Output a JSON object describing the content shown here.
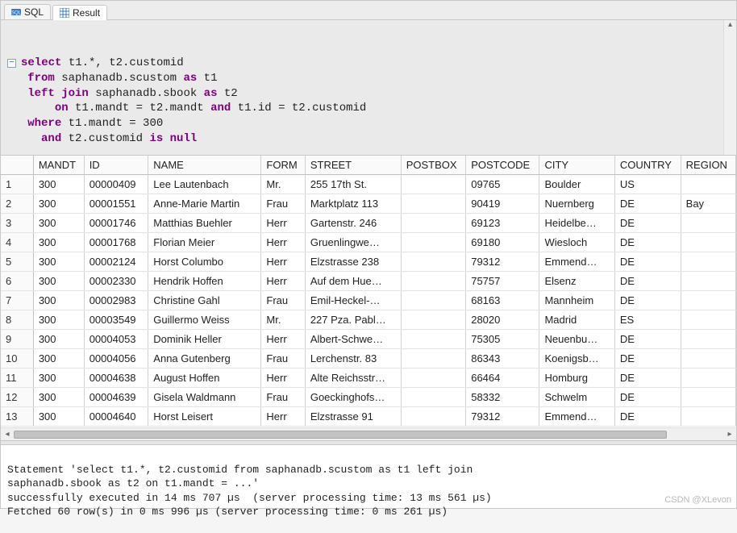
{
  "tabs": {
    "sql_label": "SQL",
    "result_label": "Result"
  },
  "sql": {
    "kw_select": "select",
    "t_sel": " t1.*, t2.customid",
    "kw_from": "from",
    "t_from": " saphanadb.scustom ",
    "kw_as1": "as",
    "t_as1": " t1",
    "kw_left": "left join",
    "t_lj": " saphanadb.sbook ",
    "kw_as2": "as",
    "t_as2": " t2",
    "kw_on": "on",
    "t_on1": " t1.mandt = t2.mandt ",
    "kw_and_on": "and",
    "t_on2": " t1.id = t2.customid",
    "kw_where": "where",
    "t_where": " t1.mandt = 300",
    "kw_and": "and",
    "t_and": " t2.customid ",
    "kw_is": "is null"
  },
  "columns": [
    "MANDT",
    "ID",
    "NAME",
    "FORM",
    "STREET",
    "POSTBOX",
    "POSTCODE",
    "CITY",
    "COUNTRY",
    "REGION"
  ],
  "rows": [
    {
      "n": "1",
      "MANDT": "300",
      "ID": "00000409",
      "NAME": "Lee Lautenbach",
      "FORM": "Mr.",
      "STREET": "255 17th St.",
      "POSTBOX": "",
      "POSTCODE": "09765",
      "CITY": "Boulder",
      "COUNTRY": "US",
      "REGION": ""
    },
    {
      "n": "2",
      "MANDT": "300",
      "ID": "00001551",
      "NAME": "Anne-Marie Martin",
      "FORM": "Frau",
      "STREET": "Marktplatz 113",
      "POSTBOX": "",
      "POSTCODE": "90419",
      "CITY": "Nuernberg",
      "COUNTRY": "DE",
      "REGION": "Bay"
    },
    {
      "n": "3",
      "MANDT": "300",
      "ID": "00001746",
      "NAME": "Matthias Buehler",
      "FORM": "Herr",
      "STREET": "Gartenstr. 246",
      "POSTBOX": "",
      "POSTCODE": "69123",
      "CITY": "Heidelbe…",
      "COUNTRY": "DE",
      "REGION": ""
    },
    {
      "n": "4",
      "MANDT": "300",
      "ID": "00001768",
      "NAME": "Florian Meier",
      "FORM": "Herr",
      "STREET": "Gruenlingwe…",
      "POSTBOX": "",
      "POSTCODE": "69180",
      "CITY": "Wiesloch",
      "COUNTRY": "DE",
      "REGION": ""
    },
    {
      "n": "5",
      "MANDT": "300",
      "ID": "00002124",
      "NAME": "Horst Columbo",
      "FORM": "Herr",
      "STREET": "Elzstrasse 238",
      "POSTBOX": "",
      "POSTCODE": "79312",
      "CITY": "Emmend…",
      "COUNTRY": "DE",
      "REGION": ""
    },
    {
      "n": "6",
      "MANDT": "300",
      "ID": "00002330",
      "NAME": "Hendrik Hoffen",
      "FORM": "Herr",
      "STREET": "Auf dem Hue…",
      "POSTBOX": "",
      "POSTCODE": "75757",
      "CITY": "Elsenz",
      "COUNTRY": "DE",
      "REGION": ""
    },
    {
      "n": "7",
      "MANDT": "300",
      "ID": "00002983",
      "NAME": "Christine Gahl",
      "FORM": "Frau",
      "STREET": "Emil-Heckel-…",
      "POSTBOX": "",
      "POSTCODE": "68163",
      "CITY": "Mannheim",
      "COUNTRY": "DE",
      "REGION": ""
    },
    {
      "n": "8",
      "MANDT": "300",
      "ID": "00003549",
      "NAME": "Guillermo Weiss",
      "FORM": "Mr.",
      "STREET": "227 Pza. Pabl…",
      "POSTBOX": "",
      "POSTCODE": "28020",
      "CITY": "Madrid",
      "COUNTRY": "ES",
      "REGION": ""
    },
    {
      "n": "9",
      "MANDT": "300",
      "ID": "00004053",
      "NAME": "Dominik Heller",
      "FORM": "Herr",
      "STREET": "Albert-Schwe…",
      "POSTBOX": "",
      "POSTCODE": "75305",
      "CITY": "Neuenbu…",
      "COUNTRY": "DE",
      "REGION": ""
    },
    {
      "n": "10",
      "MANDT": "300",
      "ID": "00004056",
      "NAME": "Anna Gutenberg",
      "FORM": "Frau",
      "STREET": "Lerchenstr. 83",
      "POSTBOX": "",
      "POSTCODE": "86343",
      "CITY": "Koenigsb…",
      "COUNTRY": "DE",
      "REGION": ""
    },
    {
      "n": "11",
      "MANDT": "300",
      "ID": "00004638",
      "NAME": "August Hoffen",
      "FORM": "Herr",
      "STREET": "Alte Reichsstr…",
      "POSTBOX": "",
      "POSTCODE": "66464",
      "CITY": "Homburg",
      "COUNTRY": "DE",
      "REGION": ""
    },
    {
      "n": "12",
      "MANDT": "300",
      "ID": "00004639",
      "NAME": "Gisela Waldmann",
      "FORM": "Frau",
      "STREET": "Goeckinghofs…",
      "POSTBOX": "",
      "POSTCODE": "58332",
      "CITY": "Schwelm",
      "COUNTRY": "DE",
      "REGION": ""
    },
    {
      "n": "13",
      "MANDT": "300",
      "ID": "00004640",
      "NAME": "Horst Leisert",
      "FORM": "Herr",
      "STREET": "Elzstrasse 91",
      "POSTBOX": "",
      "POSTCODE": "79312",
      "CITY": "Emmend…",
      "COUNTRY": "DE",
      "REGION": ""
    }
  ],
  "console": {
    "l1": "Statement 'select t1.*, t2.customid from saphanadb.scustom as t1 left join",
    "l2": "saphanadb.sbook as t2 on t1.mandt = ...'",
    "l3": "successfully executed in 14 ms 707 µs  (server processing time: 13 ms 561 µs)",
    "l4": "Fetched 60 row(s) in 0 ms 996 µs (server processing time: 0 ms 261 µs)"
  },
  "watermark": "CSDN @XLevon"
}
